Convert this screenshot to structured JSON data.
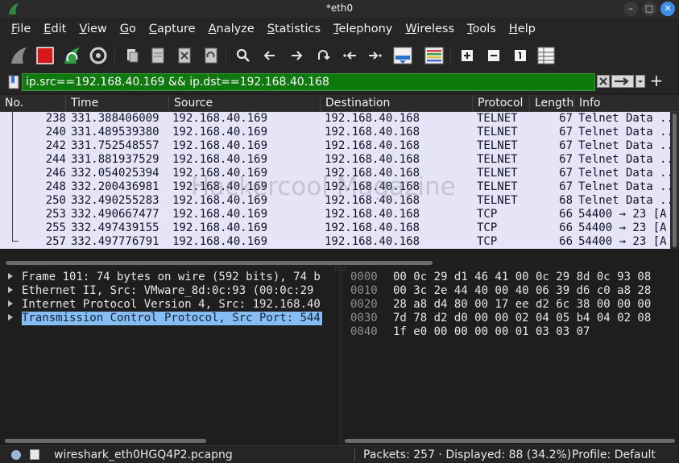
{
  "window": {
    "title": "*eth0"
  },
  "menu": [
    "File",
    "Edit",
    "View",
    "Go",
    "Capture",
    "Analyze",
    "Statistics",
    "Telephony",
    "Wireless",
    "Tools",
    "Help"
  ],
  "toolbar": {
    "icons": [
      "shark-fin-start-icon",
      "stop-capture-icon",
      "restart-capture-icon",
      "capture-options-icon",
      "open-file-icon",
      "save-file-icon",
      "close-file-icon",
      "reload-file-icon",
      "find-packet-icon",
      "go-back-icon",
      "go-forward-icon",
      "go-to-packet-icon",
      "first-packet-icon",
      "last-packet-icon",
      "autoscroll-icon",
      "colorize-icon",
      "zoom-in-icon",
      "zoom-out-icon",
      "normal-size-icon",
      "resize-columns-icon"
    ]
  },
  "filter": {
    "value": "ip.src==192.168.40.169 && ip.dst==192.168.40.168"
  },
  "packet_list": {
    "columns": [
      "No.",
      "Time",
      "Source",
      "Destination",
      "Protocol",
      "Length",
      "Info"
    ],
    "rows": [
      {
        "no": "238",
        "time": "331.388406009",
        "src": "192.168.40.169",
        "dst": "192.168.40.168",
        "proto": "TELNET",
        "len": "67",
        "info": "Telnet Data ..."
      },
      {
        "no": "240",
        "time": "331.489539380",
        "src": "192.168.40.169",
        "dst": "192.168.40.168",
        "proto": "TELNET",
        "len": "67",
        "info": "Telnet Data ..."
      },
      {
        "no": "242",
        "time": "331.752548557",
        "src": "192.168.40.169",
        "dst": "192.168.40.168",
        "proto": "TELNET",
        "len": "67",
        "info": "Telnet Data ..."
      },
      {
        "no": "244",
        "time": "331.881937529",
        "src": "192.168.40.169",
        "dst": "192.168.40.168",
        "proto": "TELNET",
        "len": "67",
        "info": "Telnet Data ..."
      },
      {
        "no": "246",
        "time": "332.054025394",
        "src": "192.168.40.169",
        "dst": "192.168.40.168",
        "proto": "TELNET",
        "len": "67",
        "info": "Telnet Data ..."
      },
      {
        "no": "248",
        "time": "332.200436981",
        "src": "192.168.40.169",
        "dst": "192.168.40.168",
        "proto": "TELNET",
        "len": "67",
        "info": "Telnet Data ..."
      },
      {
        "no": "250",
        "time": "332.490255283",
        "src": "192.168.40.169",
        "dst": "192.168.40.168",
        "proto": "TELNET",
        "len": "68",
        "info": "Telnet Data ..."
      },
      {
        "no": "253",
        "time": "332.490667477",
        "src": "192.168.40.169",
        "dst": "192.168.40.168",
        "proto": "TCP",
        "len": "66",
        "info": "54400 → 23 [A"
      },
      {
        "no": "255",
        "time": "332.497439155",
        "src": "192.168.40.169",
        "dst": "192.168.40.168",
        "proto": "TCP",
        "len": "66",
        "info": "54400 → 23 [A"
      },
      {
        "no": "257",
        "time": "332.497776791",
        "src": "192.168.40.169",
        "dst": "192.168.40.168",
        "proto": "TCP",
        "len": "66",
        "info": "54400 → 23 [A"
      }
    ]
  },
  "details": {
    "items": [
      {
        "text": "Frame 101: 74 bytes on wire (592 bits), 74 b",
        "selected": false
      },
      {
        "text": "Ethernet II, Src: VMware_8d:0c:93 (00:0c:29",
        "selected": false
      },
      {
        "text": "Internet Protocol Version 4, Src: 192.168.40",
        "selected": false
      },
      {
        "text": "Transmission Control Protocol, Src Port: 544",
        "selected": true
      }
    ]
  },
  "bytes": {
    "rows": [
      {
        "offset": "0000",
        "hex": "00 0c 29 d1 46 41 00 0c  29 8d 0c 93 08"
      },
      {
        "offset": "0010",
        "hex": "00 3c 2e 44 40 00 40 06  39 d6 c0 a8 28"
      },
      {
        "offset": "0020",
        "hex": "28 a8 d4 80 00 17 ee d2  6c 38 00 00 00"
      },
      {
        "offset": "0030",
        "hex": "7d 78 d2 d0 00 00 02 04  05 b4 04 02 08"
      },
      {
        "offset": "0040",
        "hex": "1f e0 00 00 00 00 01 03  03 07"
      }
    ]
  },
  "status": {
    "file": "wireshark_eth0HGQ4P2.pcapng",
    "packets": "Packets: 257 · Displayed: 88 (34.2%)",
    "profile": "Profile: Default"
  },
  "watermark": "Hackercool Magazine",
  "colors": {
    "filter_valid": "#0e7a0e",
    "row_bg": "#e5e5f7",
    "selection": "#86bdf3"
  }
}
